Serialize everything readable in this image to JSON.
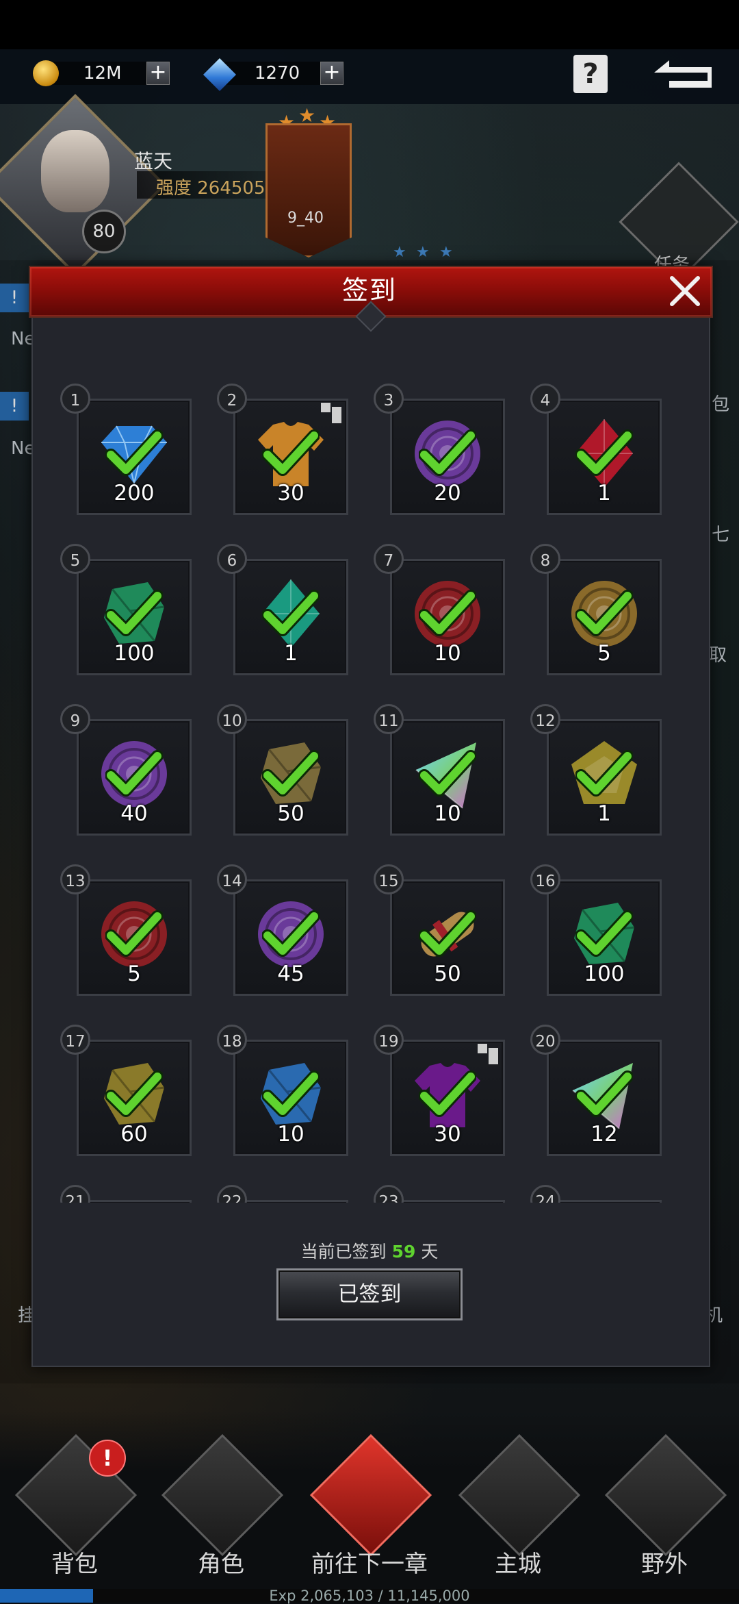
{
  "resources": {
    "gold": "12M",
    "gems": "1270"
  },
  "player": {
    "name": "蓝天",
    "power_label": "强度 264505",
    "level": "80"
  },
  "chapter": {
    "label": "9_40"
  },
  "side_panel": {
    "quest_label": "任务",
    "news_1": "Ne",
    "news_2": "Ne",
    "right_1": "包",
    "right_2": "七",
    "right_3": "取",
    "left_bottom": "挂",
    "right_bottom": "机"
  },
  "dialog": {
    "title": "签到",
    "close_icon": "close-icon",
    "signed_prefix": "当前已签到",
    "signed_days": "59",
    "signed_suffix": "天",
    "button_label": "已签到",
    "colors": {
      "header": "#9c110b",
      "check": "#5fd32f",
      "days": "#5fd32f"
    }
  },
  "rewards": [
    {
      "day": "1",
      "qty": "200",
      "icon": "blue-diamond-icon",
      "color": "#2d7fd6",
      "shape": "gem",
      "multi": false
    },
    {
      "day": "2",
      "qty": "30",
      "icon": "orange-shirt-icon",
      "color": "#c98429",
      "shape": "shirt",
      "multi": true
    },
    {
      "day": "3",
      "qty": "20",
      "icon": "purple-coin-icon",
      "color": "#6a3a9a",
      "shape": "coin",
      "multi": false
    },
    {
      "day": "4",
      "qty": "1",
      "icon": "red-crystal-icon",
      "color": "#b0182a",
      "shape": "diamond",
      "multi": false
    },
    {
      "day": "5",
      "qty": "100",
      "icon": "green-ore-icon",
      "color": "#1f8a5a",
      "shape": "ore",
      "multi": false
    },
    {
      "day": "6",
      "qty": "1",
      "icon": "teal-crystal-icon",
      "color": "#1a9a80",
      "shape": "diamond",
      "multi": false
    },
    {
      "day": "7",
      "qty": "10",
      "icon": "red-coin-icon",
      "color": "#8a1f24",
      "shape": "coin",
      "multi": false
    },
    {
      "day": "8",
      "qty": "5",
      "icon": "gold-coin-icon",
      "color": "#8a6a2a",
      "shape": "coin",
      "multi": false
    },
    {
      "day": "9",
      "qty": "40",
      "icon": "purple-coin-icon",
      "color": "#6a3a9a",
      "shape": "coin",
      "multi": false
    },
    {
      "day": "10",
      "qty": "50",
      "icon": "brown-ore-icon",
      "color": "#7a6a3a",
      "shape": "ore",
      "multi": false
    },
    {
      "day": "11",
      "qty": "10",
      "icon": "rainbow-prism-icon",
      "color": "#5fb0a0",
      "shape": "prism",
      "multi": false
    },
    {
      "day": "12",
      "qty": "1",
      "icon": "yellow-gem-icon",
      "color": "#9a8a2a",
      "shape": "pentagon",
      "multi": false
    },
    {
      "day": "13",
      "qty": "5",
      "icon": "red-coin-icon",
      "color": "#8a1f24",
      "shape": "coin",
      "multi": false
    },
    {
      "day": "14",
      "qty": "45",
      "icon": "purple-coin-icon",
      "color": "#6a3a9a",
      "shape": "coin",
      "multi": false
    },
    {
      "day": "15",
      "qty": "50",
      "icon": "scroll-icon",
      "color": "#b08a4a",
      "shape": "scroll",
      "multi": false
    },
    {
      "day": "16",
      "qty": "100",
      "icon": "green-ore-icon",
      "color": "#1f8a5a",
      "shape": "ore",
      "multi": false
    },
    {
      "day": "17",
      "qty": "60",
      "icon": "yellow-ore-icon",
      "color": "#8a7a2a",
      "shape": "ore",
      "multi": false
    },
    {
      "day": "18",
      "qty": "10",
      "icon": "blue-ore-icon",
      "color": "#2a6ab0",
      "shape": "ore",
      "multi": false
    },
    {
      "day": "19",
      "qty": "30",
      "icon": "purple-shirt-icon",
      "color": "#6a1a8a",
      "shape": "shirt",
      "multi": true
    },
    {
      "day": "20",
      "qty": "12",
      "icon": "rainbow-prism-icon",
      "color": "#5fb0a0",
      "shape": "prism",
      "multi": false
    },
    {
      "day": "21",
      "qty": "",
      "icon": "reward-icon",
      "color": "#444444",
      "shape": "none",
      "multi": false
    },
    {
      "day": "22",
      "qty": "",
      "icon": "reward-icon",
      "color": "#444444",
      "shape": "none",
      "multi": false
    },
    {
      "day": "23",
      "qty": "",
      "icon": "reward-icon",
      "color": "#444444",
      "shape": "none",
      "multi": false
    },
    {
      "day": "24",
      "qty": "",
      "icon": "reward-icon",
      "color": "#444444",
      "shape": "none",
      "multi": false
    }
  ],
  "bottom_nav": [
    {
      "id": "bag",
      "label": "背包",
      "icon": "backpack-icon"
    },
    {
      "id": "hero",
      "label": "角色",
      "icon": "character-icon"
    },
    {
      "id": "next",
      "label": "前往下一章",
      "icon": "demon-skull-icon"
    },
    {
      "id": "city",
      "label": "主城",
      "icon": "castle-icon"
    },
    {
      "id": "field",
      "label": "野外",
      "icon": "wilderness-icon"
    }
  ],
  "bag_alert": "!",
  "exp": {
    "label": "Exp  2,065,103 / 11,145,000",
    "fraction": 0.185
  }
}
